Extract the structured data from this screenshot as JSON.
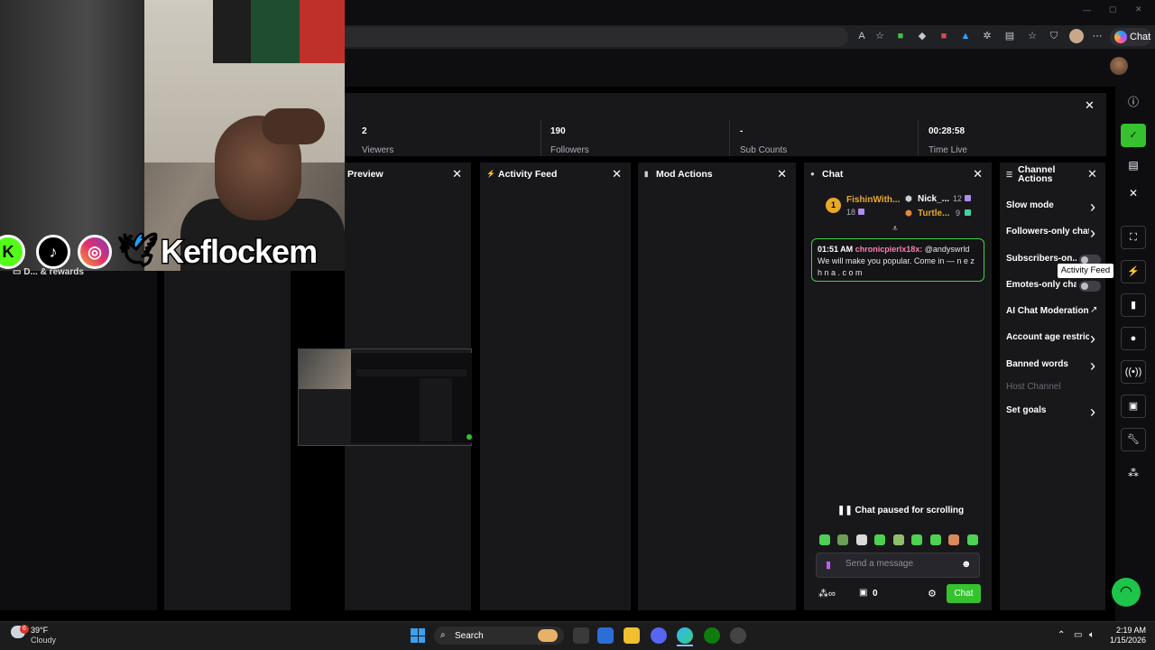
{
  "browser": {
    "chat_pill_label": "Chat"
  },
  "stats": {
    "viewers": {
      "value": "2",
      "label": "Viewers"
    },
    "followers": {
      "value": "190",
      "label": "Followers"
    },
    "sub_counts": {
      "value": "-",
      "label": "Sub Counts"
    },
    "time_live": {
      "value": "00:28:58",
      "label": "Time Live"
    }
  },
  "overlay": {
    "handle": "Keflockem",
    "rewards_label": "D... & rewards",
    "socials": [
      "kick-logo",
      "tiktok-logo",
      "instagram-logo",
      "twitter-logo"
    ]
  },
  "panels": {
    "preview": {
      "title": "Preview"
    },
    "activity_feed": {
      "title": "Activity Feed"
    },
    "mod_actions": {
      "title": "Mod Actions"
    },
    "chat": {
      "title": "Chat"
    },
    "channel_actions": {
      "title": "Channel Actions"
    }
  },
  "chat": {
    "leaderboard": [
      {
        "rank": "1",
        "name": "FishinWith...",
        "count": "18"
      },
      {
        "rank": "",
        "name": "Nick_...",
        "count": "12"
      },
      {
        "rank": "",
        "name": "Turtle...",
        "count": "9"
      }
    ],
    "message": {
      "time": "01:51 AM",
      "user": "chronicpierlx18x:",
      "text": "@andyswrld We will make you popular. Come in — n e z h n a . c o m"
    },
    "paused_label": "Chat paused for scrolling",
    "input_placeholder": "Send a message",
    "points": "0",
    "send_label": "Chat"
  },
  "channel_actions": {
    "items": [
      {
        "label": "Slow mode",
        "control": "arrow"
      },
      {
        "label": "Followers-only chat",
        "control": "arrow"
      },
      {
        "label": "Subscribers-on...",
        "control": "toggle"
      },
      {
        "label": "Emotes-only chat",
        "control": "toggle"
      },
      {
        "label": "AI Chat Moderation",
        "control": "external"
      },
      {
        "label": "Account age restric",
        "control": "arrow"
      },
      {
        "label": "Banned words",
        "control": "arrow"
      },
      {
        "label": "Host Channel",
        "control": "disabled"
      },
      {
        "label": "Set goals",
        "control": "arrow"
      }
    ],
    "tooltip": "Activity Feed"
  },
  "taskbar": {
    "temp": "39°F",
    "condition": "Cloudy",
    "weather_badge": "6",
    "search_label": "Search",
    "time": "2:19 AM",
    "date": "1/15/2026"
  },
  "colors": {
    "accent_green": "#36c22f",
    "highlight_border": "#3fd34a",
    "panel_bg": "#18181b",
    "username_pink": "#ff7eb6",
    "leader_gold": "#e8a927"
  }
}
